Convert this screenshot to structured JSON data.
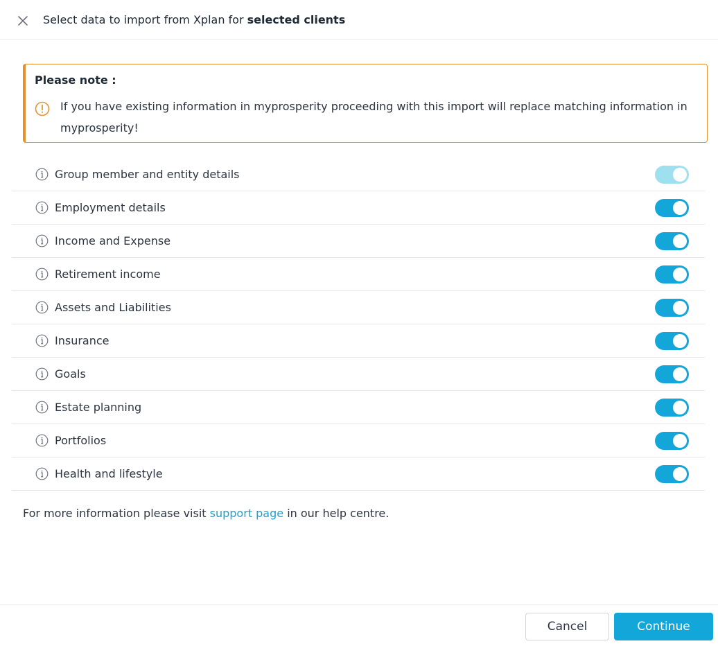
{
  "header": {
    "title_prefix": "Select data to import from Xplan for",
    "title_bold": "selected clients",
    "close_icon": "close-icon"
  },
  "note": {
    "title": "Please note :",
    "icon": "alert-circle-icon",
    "accent_color": "#e3922f",
    "text": "If you have existing information in myprosperity proceeding with this import will replace matching information in myprosperity!"
  },
  "items": [
    {
      "label": "Group member and entity details",
      "on": true,
      "disabled": true
    },
    {
      "label": "Employment details",
      "on": true,
      "disabled": false
    },
    {
      "label": "Income and Expense",
      "on": true,
      "disabled": false
    },
    {
      "label": "Retirement income",
      "on": true,
      "disabled": false
    },
    {
      "label": "Assets and Liabilities",
      "on": true,
      "disabled": false
    },
    {
      "label": "Insurance",
      "on": true,
      "disabled": false
    },
    {
      "label": "Goals",
      "on": true,
      "disabled": false
    },
    {
      "label": "Estate planning",
      "on": true,
      "disabled": false
    },
    {
      "label": "Portfolios",
      "on": true,
      "disabled": false
    },
    {
      "label": "Health and lifestyle",
      "on": true,
      "disabled": false
    }
  ],
  "footer": {
    "info_prefix": "For more information please visit",
    "link_text": "support page",
    "info_suffix": "in our help centre."
  },
  "buttons": {
    "cancel": "Cancel",
    "continue": "Continue"
  },
  "colors": {
    "accent": "#13a6d8",
    "toggle_disabled": "#9fe0ee",
    "warning": "#e3922f"
  }
}
